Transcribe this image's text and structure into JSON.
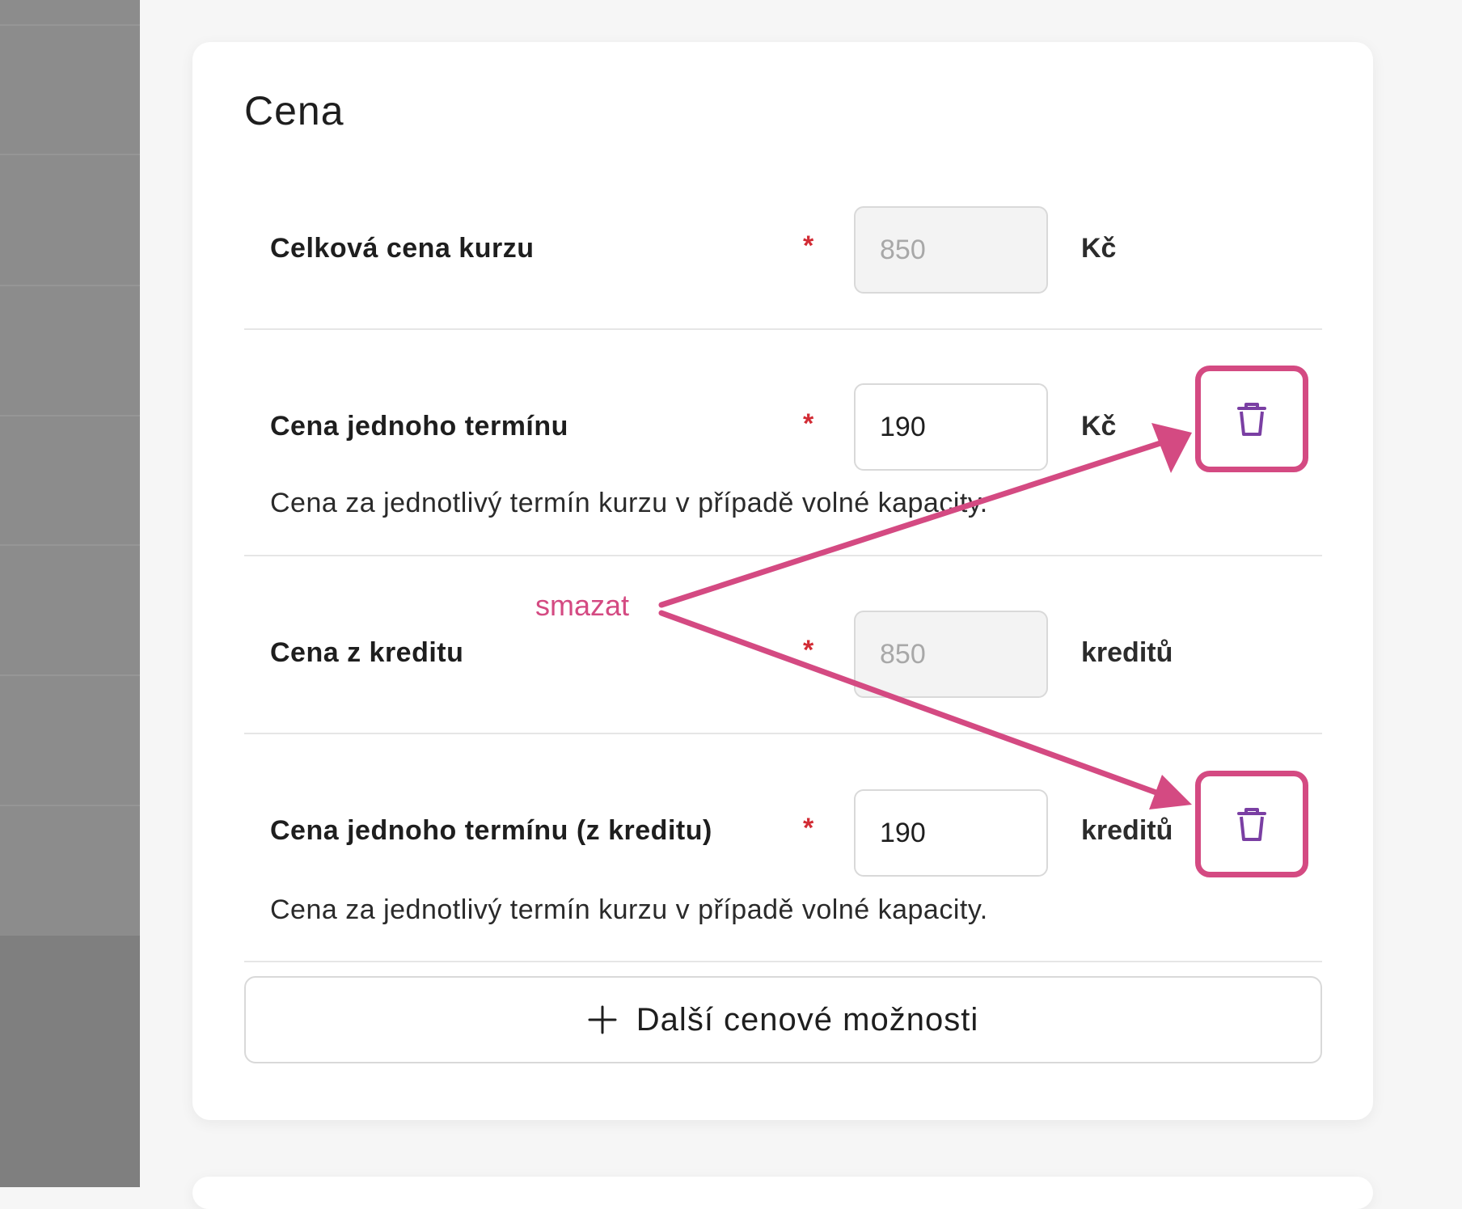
{
  "section": {
    "title": "Cena"
  },
  "rows": [
    {
      "label": "Celková cena kurzu",
      "required_mark": "*",
      "value": "850",
      "unit": "Kč",
      "disabled": true
    },
    {
      "label": "Cena jednoho termínu",
      "required_mark": "*",
      "value": "190",
      "unit": "Kč",
      "hint": "Cena za jednotlivý termín kurzu v případě volné kapacity.",
      "disabled": false,
      "delete_icon": "trash-icon"
    },
    {
      "label": "Cena z kreditu",
      "required_mark": "*",
      "value": "850",
      "unit": "kreditů",
      "disabled": true
    },
    {
      "label": "Cena jednoho termínu (z kreditu)",
      "required_mark": "*",
      "value": "190",
      "unit": "kreditů",
      "hint": "Cena za jednotlivý termín kurzu v případě volné kapacity.",
      "disabled": false,
      "delete_icon": "trash-icon"
    }
  ],
  "add_button": {
    "icon": "plus-icon",
    "label": "Další cenové možnosti"
  },
  "annotation": {
    "text": "smazat",
    "color": "#d44a82"
  },
  "colors": {
    "required": "#d22c35",
    "trash_icon": "#7a3fa3",
    "highlight": "#d44a82"
  }
}
